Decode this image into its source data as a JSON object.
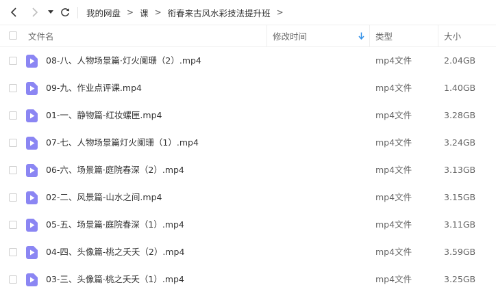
{
  "nav": {
    "breadcrumb": [
      "我的网盘",
      "课",
      "衔春来古风水彩技法提升班"
    ],
    "separator": ">"
  },
  "table": {
    "columns": {
      "name": "文件名",
      "modified": "修改时间",
      "type": "类型",
      "size": "大小"
    },
    "sort_icon": "sort-down-arrow-icon",
    "rows": [
      {
        "name": "08-八、人物场景篇·灯火阑珊（2）.mp4",
        "type": "mp4文件",
        "size": "2.04GB"
      },
      {
        "name": "09-九、作业点评课.mp4",
        "type": "mp4文件",
        "size": "1.40GB"
      },
      {
        "name": "01-一、静物篇-红妆螺匣.mp4",
        "type": "mp4文件",
        "size": "3.28GB"
      },
      {
        "name": "07-七、人物场景篇灯火阑珊（1）.mp4",
        "type": "mp4文件",
        "size": "3.24GB"
      },
      {
        "name": "06-六、场景篇·庭院春深（2）.mp4",
        "type": "mp4文件",
        "size": "3.13GB"
      },
      {
        "name": "02-二、风景篇-山水之间.mp4",
        "type": "mp4文件",
        "size": "3.15GB"
      },
      {
        "name": "05-五、场景篇·庭院春深（1）.mp4",
        "type": "mp4文件",
        "size": "3.11GB"
      },
      {
        "name": "04-四、头像篇-桃之夭夭（2）.mp4",
        "type": "mp4文件",
        "size": "3.59GB"
      },
      {
        "name": "03-三、头像篇·桃之夭夭（1）.mp4",
        "type": "mp4文件",
        "size": "3.25GB"
      }
    ]
  },
  "colors": {
    "video_icon": "#8b86f3",
    "sort_arrow": "#2f8fe8",
    "text": "#333333",
    "muted": "#666666"
  }
}
